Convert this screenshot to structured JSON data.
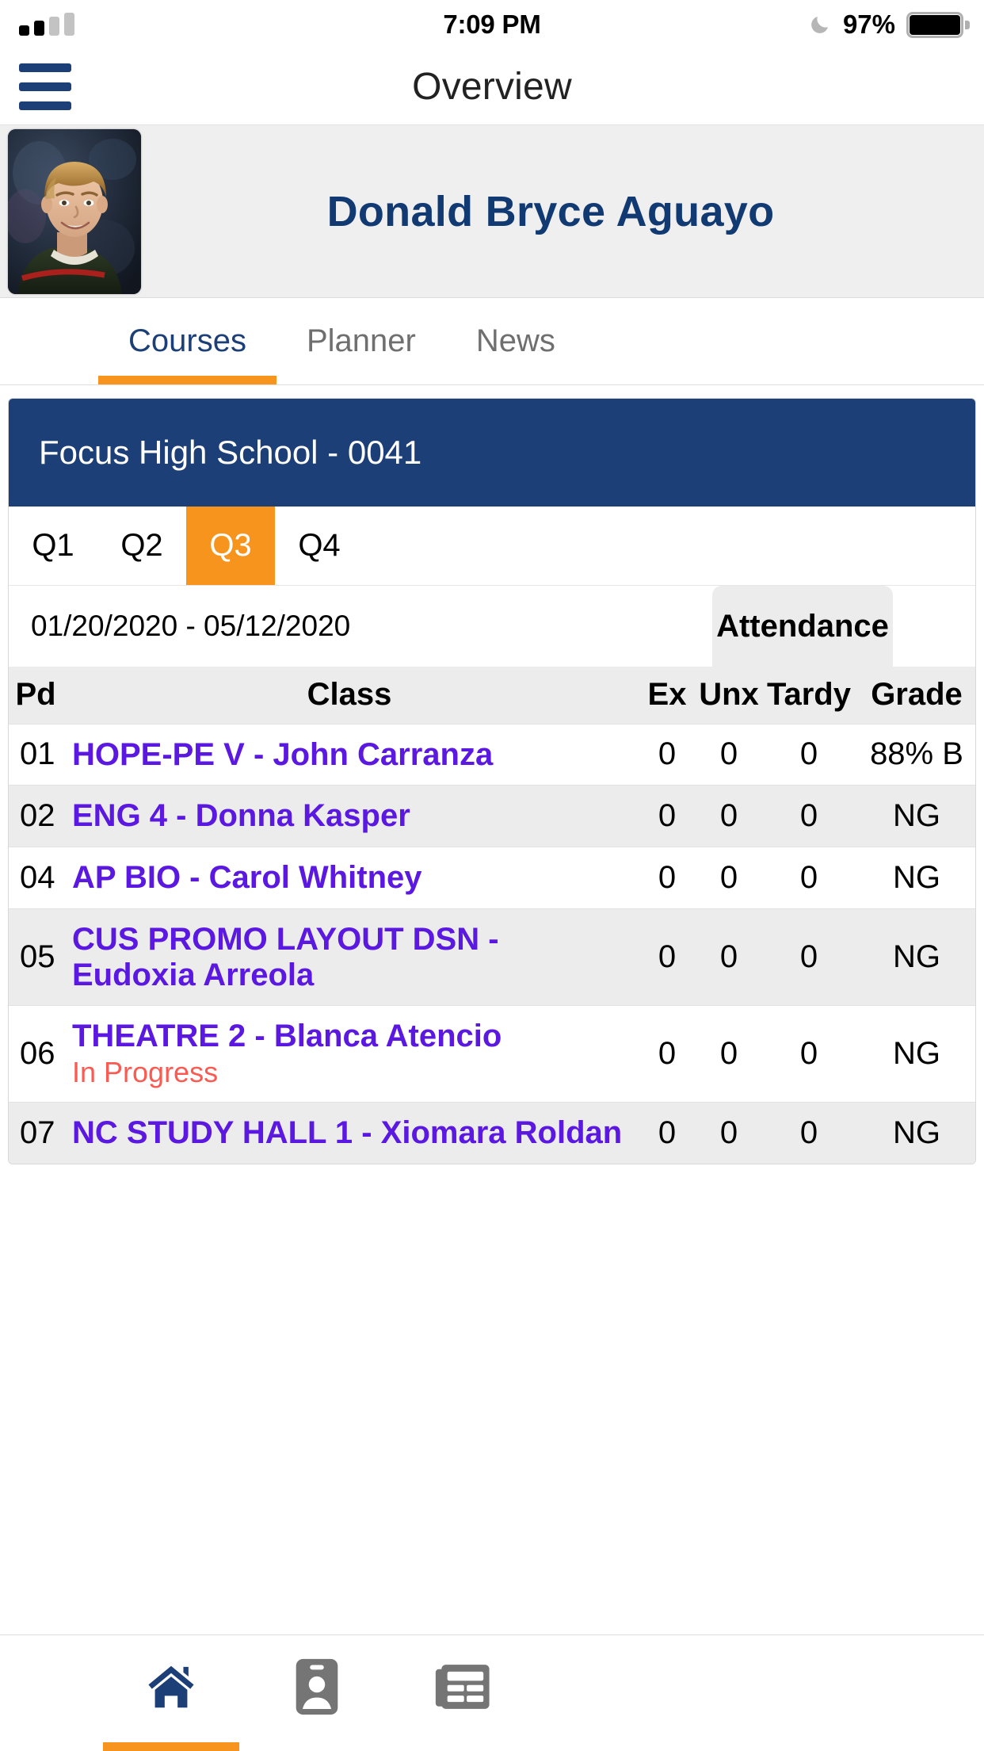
{
  "status_bar": {
    "signal_bars_filled": 2,
    "signal_bars_total": 4,
    "time": "7:09 PM",
    "battery_percent": "97%",
    "dnd_icon": "moon-icon",
    "battery_icon": "battery-full-icon"
  },
  "nav": {
    "menu_icon": "hamburger-menu-icon",
    "title": "Overview"
  },
  "student": {
    "name": "Donald Bryce Aguayo",
    "photo_alt": "student-portrait"
  },
  "main_tabs": [
    {
      "label": "Courses",
      "active": true
    },
    {
      "label": "Planner",
      "active": false
    },
    {
      "label": "News",
      "active": false
    }
  ],
  "course_card": {
    "school": "Focus High School - 0041",
    "quarters": [
      {
        "label": "Q1",
        "active": false
      },
      {
        "label": "Q2",
        "active": false
      },
      {
        "label": "Q3",
        "active": true
      },
      {
        "label": "Q4",
        "active": false
      }
    ],
    "date_range": "01/20/2020 - 05/12/2020",
    "attendance_tab": "Attendance",
    "columns": {
      "pd": "Pd",
      "class": "Class",
      "ex": "Ex",
      "unx": "Unx",
      "tardy": "Tardy",
      "grade": "Grade"
    },
    "rows": [
      {
        "pd": "01",
        "class": "HOPE-PE V - John Carranza",
        "status": "",
        "ex": "0",
        "unx": "0",
        "tardy": "0",
        "grade": "88% B"
      },
      {
        "pd": "02",
        "class": "ENG 4 - Donna Kasper",
        "status": "",
        "ex": "0",
        "unx": "0",
        "tardy": "0",
        "grade": "NG"
      },
      {
        "pd": "04",
        "class": "AP BIO - Carol Whitney",
        "status": "",
        "ex": "0",
        "unx": "0",
        "tardy": "0",
        "grade": "NG"
      },
      {
        "pd": "05",
        "class": "CUS PROMO LAYOUT DSN - Eudoxia Arreola",
        "status": "",
        "ex": "0",
        "unx": "0",
        "tardy": "0",
        "grade": "NG"
      },
      {
        "pd": "06",
        "class": "THEATRE 2 - Blanca Atencio",
        "status": "In Progress",
        "ex": "0",
        "unx": "0",
        "tardy": "0",
        "grade": "NG"
      },
      {
        "pd": "07",
        "class": "NC STUDY HALL 1 - Xiomara Roldan",
        "status": "",
        "ex": "0",
        "unx": "0",
        "tardy": "0",
        "grade": "NG"
      }
    ]
  },
  "bottom_nav": [
    {
      "icon": "home-icon",
      "active": true
    },
    {
      "icon": "id-badge-icon",
      "active": false
    },
    {
      "icon": "newspaper-icon",
      "active": false
    }
  ],
  "colors": {
    "brand_navy": "#1d3f77",
    "accent_orange": "#f7941e",
    "link_purple": "#5b18e0",
    "status_red": "#fb5a52",
    "row_alt_gray": "#ececec",
    "name_navy": "#123a72"
  }
}
